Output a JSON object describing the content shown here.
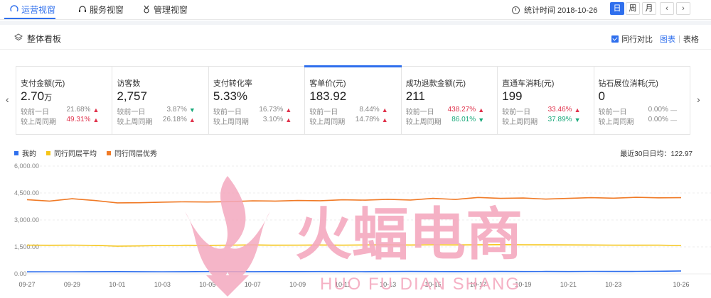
{
  "nav": {
    "tabs": [
      {
        "label": "运营视窗",
        "icon": "dashboard-icon"
      },
      {
        "label": "服务视窗",
        "icon": "headset-icon"
      },
      {
        "label": "管理视窗",
        "icon": "medal-icon"
      }
    ],
    "stat_time": "统计时间 2018-10-26",
    "periods": [
      "日",
      "周",
      "月"
    ],
    "active_period": "日",
    "prev": "‹",
    "next": "›"
  },
  "section": {
    "title": "整体看板",
    "compare_label": "同行对比",
    "view_chart": "图表",
    "view_sep": "|",
    "view_table": "表格"
  },
  "cards": [
    {
      "label": "支付金额(元)",
      "value": "2.70",
      "unit": "万",
      "day_label": "较前一日",
      "day_val": "21.68%",
      "day_dir": "up",
      "week_label": "较上周同期",
      "week_val": "49.31%",
      "week_dir": "up",
      "week_highlight": true
    },
    {
      "label": "访客数",
      "value": "2,757",
      "unit": "",
      "day_label": "较前一日",
      "day_val": "3.87%",
      "day_dir": "down",
      "week_label": "较上周同期",
      "week_val": "26.18%",
      "week_dir": "up"
    },
    {
      "label": "支付转化率",
      "value": "5.33%",
      "unit": "",
      "day_label": "较前一日",
      "day_val": "16.73%",
      "day_dir": "up",
      "week_label": "较上周同期",
      "week_val": "3.10%",
      "week_dir": "up"
    },
    {
      "label": "客单价(元)",
      "value": "183.92",
      "unit": "",
      "day_label": "较前一日",
      "day_val": "8.44%",
      "day_dir": "up",
      "week_label": "较上周同期",
      "week_val": "14.78%",
      "week_dir": "up",
      "selected": true
    },
    {
      "label": "成功退款金额(元)",
      "value": "211",
      "unit": "",
      "day_label": "较前一日",
      "day_val": "438.27%",
      "day_dir": "up",
      "day_highlight": true,
      "week_label": "较上周同期",
      "week_val": "86.01%",
      "week_dir": "down",
      "week_highlight": true
    },
    {
      "label": "直通车消耗(元)",
      "value": "199",
      "unit": "",
      "day_label": "较前一日",
      "day_val": "33.46%",
      "day_dir": "up",
      "day_highlight": true,
      "week_label": "较上周同期",
      "week_val": "37.89%",
      "week_dir": "down",
      "week_highlight": true
    },
    {
      "label": "钻石展位消耗(元)",
      "value": "0",
      "unit": "",
      "day_label": "较前一日",
      "day_val": "0.00%",
      "day_dir": "flat",
      "week_label": "较上周同期",
      "week_val": "0.00%",
      "week_dir": "flat"
    }
  ],
  "legend": [
    {
      "name": "我的",
      "color": "#2f6fed"
    },
    {
      "name": "同行同层平均",
      "color": "#f5c518"
    },
    {
      "name": "同行同层优秀",
      "color": "#f07a26"
    }
  ],
  "avg30": "最近30日日均：122.97",
  "watermark": {
    "cn": "火蝠电商",
    "en": "HUO FU DIAN SHANG"
  },
  "colors": {
    "accent": "#2f6fed",
    "up": "#e0334c",
    "down": "#19a97b"
  },
  "chart_data": {
    "type": "line",
    "x": [
      "09-27",
      "09-28",
      "09-29",
      "09-30",
      "10-01",
      "10-02",
      "10-03",
      "10-04",
      "10-05",
      "10-06",
      "10-07",
      "10-08",
      "10-09",
      "10-10",
      "10-11",
      "10-12",
      "10-13",
      "10-14",
      "10-15",
      "10-16",
      "10-17",
      "10-18",
      "10-19",
      "10-20",
      "10-21",
      "10-22",
      "10-23",
      "10-24",
      "10-25",
      "10-26"
    ],
    "x_tick_labels": [
      "09-27",
      "09-29",
      "10-01",
      "10-03",
      "10-05",
      "10-07",
      "10-09",
      "10-11",
      "10-13",
      "10-15",
      "10-17",
      "10-19",
      "10-21",
      "10-23",
      "10-26"
    ],
    "y_tick_labels": [
      "6,000.00",
      "4,500.00",
      "3,000.00",
      "1,500.00",
      "0.00"
    ],
    "ylim": [
      0,
      6000
    ],
    "grid": true,
    "series": [
      {
        "name": "我的",
        "color": "#2f6fed",
        "values": [
          115,
          120,
          118,
          122,
          125,
          121,
          119,
          123,
          130,
          127,
          124,
          125,
          128,
          131,
          126,
          124,
          129,
          133,
          130,
          127,
          131,
          134,
          129,
          136,
          132,
          138,
          135,
          140,
          145,
          160
        ]
      },
      {
        "name": "同行同层平均",
        "color": "#f5c518",
        "values": [
          1600,
          1590,
          1600,
          1585,
          1545,
          1555,
          1580,
          1590,
          1585,
          1600,
          1610,
          1595,
          1600,
          1605,
          1600,
          1610,
          1615,
          1605,
          1620,
          1610,
          1615,
          1625,
          1620,
          1615,
          1610,
          1605,
          1600,
          1595,
          1600,
          1580
        ]
      },
      {
        "name": "同行同层优秀",
        "color": "#f07a26",
        "values": [
          4130,
          4050,
          4180,
          4080,
          3950,
          3960,
          3990,
          4010,
          4000,
          4020,
          4060,
          4050,
          4080,
          4070,
          4120,
          4100,
          4150,
          4110,
          4200,
          4140,
          4250,
          4200,
          4220,
          4160,
          4200,
          4240,
          4210,
          4260,
          4230,
          4240
        ]
      }
    ]
  }
}
